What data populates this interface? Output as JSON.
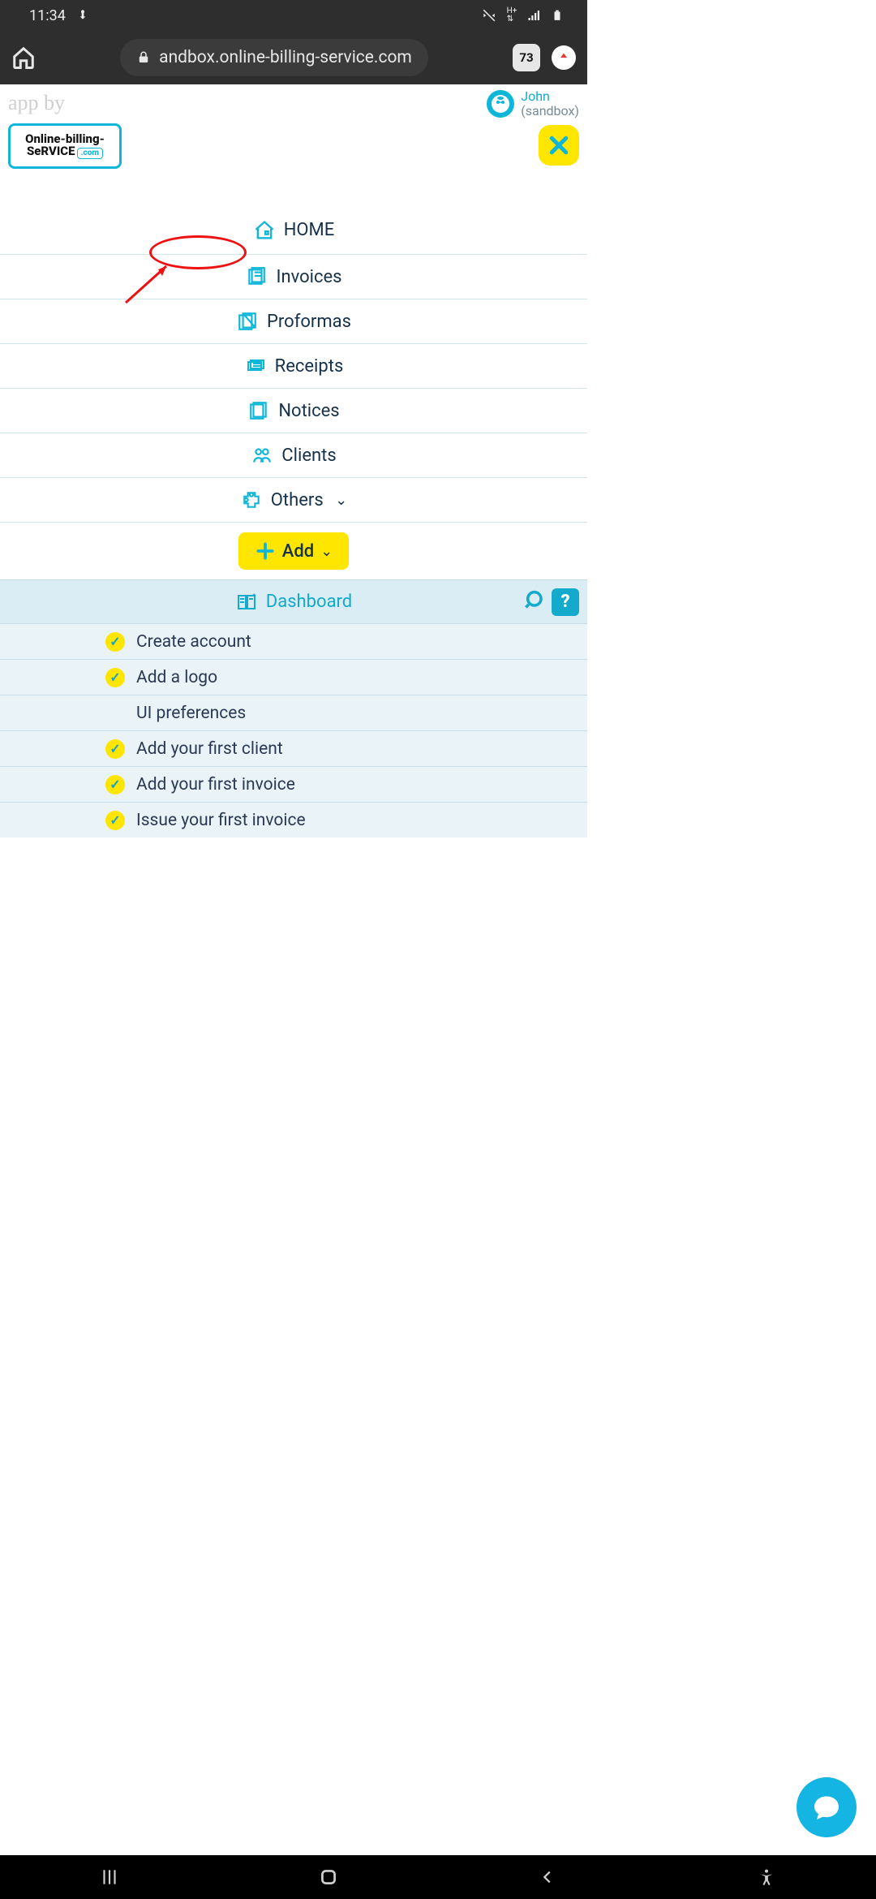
{
  "statusbar": {
    "time": "11:34"
  },
  "browser": {
    "url": "andbox.online-billing-service.com",
    "tab_count": "73"
  },
  "header": {
    "app_by": "app by",
    "logo_line1": "Online-billing-",
    "logo_line2": "SeRVICE",
    "logo_tld": ".com",
    "user_name": "John",
    "user_mode": "(sandbox)"
  },
  "nav": {
    "items": [
      {
        "label": "HOME",
        "icon": "home"
      },
      {
        "label": "Invoices",
        "icon": "invoices"
      },
      {
        "label": "Proformas",
        "icon": "proformas"
      },
      {
        "label": "Receipts",
        "icon": "receipts"
      },
      {
        "label": "Notices",
        "icon": "notices"
      },
      {
        "label": "Clients",
        "icon": "clients"
      },
      {
        "label": "Others",
        "icon": "puzzle",
        "dropdown": true
      }
    ],
    "add_label": "Add"
  },
  "dashboard": {
    "title": "Dashboard",
    "tasks": [
      {
        "label": "Create account",
        "done": true
      },
      {
        "label": "Add a logo",
        "done": true
      },
      {
        "label": "UI preferences",
        "done": false
      },
      {
        "label": "Add your first client",
        "done": true
      },
      {
        "label": "Add your first invoice",
        "done": true
      },
      {
        "label": "Issue your first invoice",
        "done": true
      }
    ]
  }
}
